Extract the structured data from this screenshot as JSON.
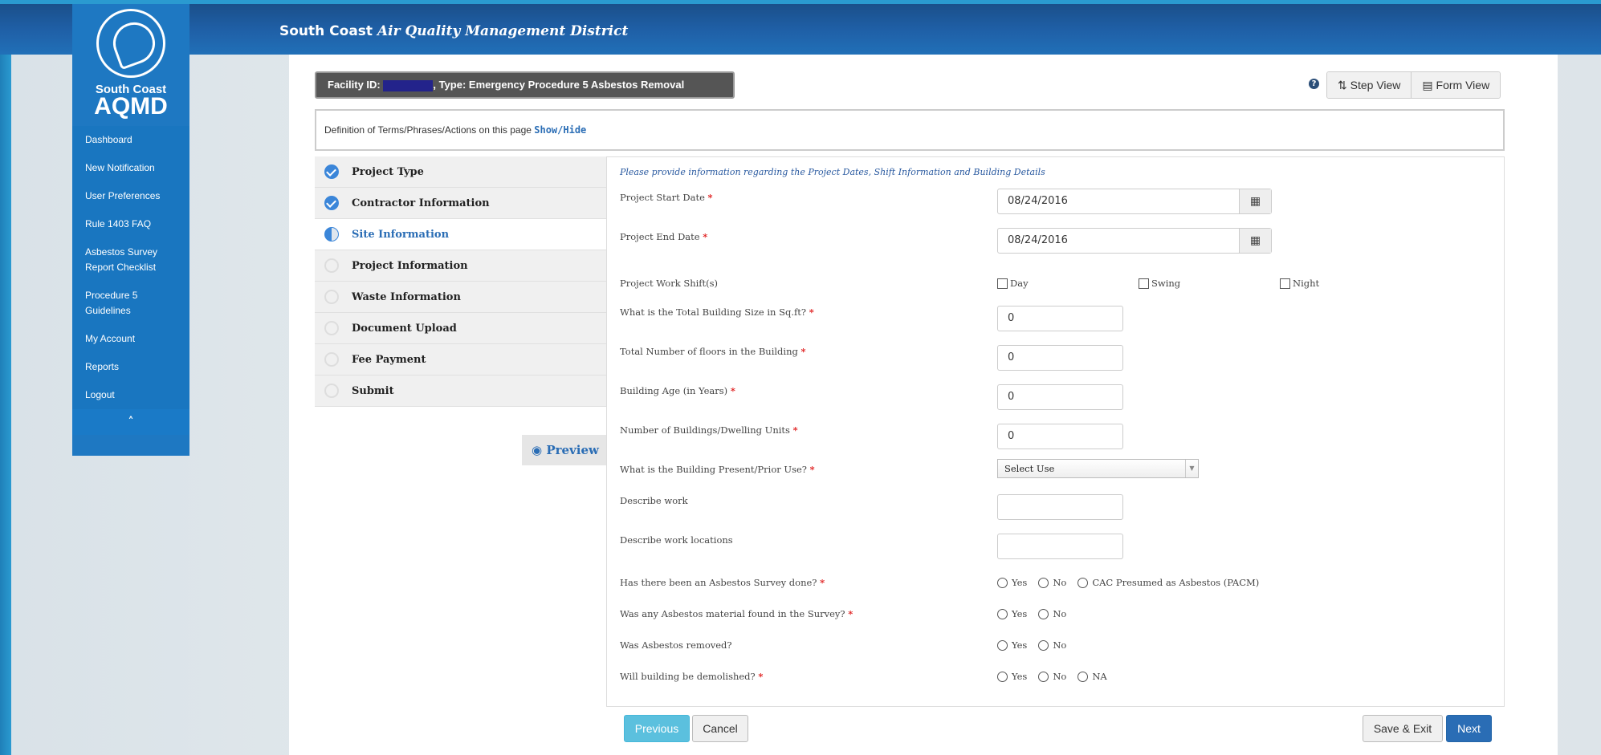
{
  "header": {
    "org_plain": "South Coast ",
    "org_italic": "Air Quality Management District"
  },
  "sidebar": {
    "logo_line1": "South Coast",
    "logo_line2": "AQMD",
    "items": [
      {
        "label": "Dashboard"
      },
      {
        "label": "New Notification"
      },
      {
        "label": "User Preferences"
      },
      {
        "label": "Rule 1403 FAQ"
      },
      {
        "label": "Asbestos Survey Report Checklist"
      },
      {
        "label": "Procedure 5 Guidelines"
      },
      {
        "label": "My Account"
      },
      {
        "label": "Reports"
      },
      {
        "label": "Logout"
      }
    ],
    "collapse_icon": "chevron-up-icon"
  },
  "facility": {
    "prefix": "Facility ID: ",
    "suffix": ", Type: Emergency Procedure 5 Asbestos Removal"
  },
  "views": {
    "step_label": "Step View",
    "form_label": "Form View"
  },
  "definitions": {
    "text": "Definition of Terms/Phrases/Actions on this page ",
    "link": "Show/Hide"
  },
  "steps": [
    {
      "label": "Project Type",
      "status": "done"
    },
    {
      "label": "Contractor Information",
      "status": "done"
    },
    {
      "label": "Site Information",
      "status": "active"
    },
    {
      "label": "Project Information",
      "status": "todo"
    },
    {
      "label": "Waste Information",
      "status": "todo"
    },
    {
      "label": "Document Upload",
      "status": "todo"
    },
    {
      "label": "Fee Payment",
      "status": "todo"
    },
    {
      "label": "Submit",
      "status": "todo"
    }
  ],
  "preview_label": "Preview",
  "form": {
    "intro": "Please provide information regarding the Project Dates, Shift Information and Building Details",
    "required_mark": "*",
    "start_date": {
      "label": "Project Start Date",
      "value": "08/24/2016"
    },
    "end_date": {
      "label": "Project End Date",
      "value": "08/24/2016"
    },
    "work_shifts": {
      "label": "Project Work Shift(s)",
      "options": [
        "Day",
        "Swing",
        "Night"
      ]
    },
    "building_size": {
      "label": "What is the Total Building Size in Sq.ft?",
      "value": "0"
    },
    "floors": {
      "label": "Total Number of floors in the Building",
      "value": "0"
    },
    "age": {
      "label": "Building Age (in Years)",
      "value": "0"
    },
    "num_buildings": {
      "label": "Number of Buildings/Dwelling Units",
      "value": "0"
    },
    "prior_use": {
      "label": "What is the Building Present/Prior Use?",
      "value": "Select Use"
    },
    "describe_work": {
      "label": "Describe work",
      "value": ""
    },
    "describe_locations": {
      "label": "Describe work locations",
      "value": ""
    },
    "survey_done": {
      "label": "Has there been an Asbestos Survey done?",
      "options": [
        "Yes",
        "No",
        "CAC Presumed as Asbestos (PACM)"
      ]
    },
    "material_found": {
      "label": "Was any Asbestos material found in the Survey?",
      "options": [
        "Yes",
        "No"
      ]
    },
    "removed": {
      "label": "Was Asbestos removed?",
      "options": [
        "Yes",
        "No"
      ]
    },
    "demolished": {
      "label": "Will building be demolished?",
      "options": [
        "Yes",
        "No",
        "NA"
      ]
    }
  },
  "buttons": {
    "previous": "Previous",
    "cancel": "Cancel",
    "save_exit": "Save & Exit",
    "next": "Next"
  }
}
